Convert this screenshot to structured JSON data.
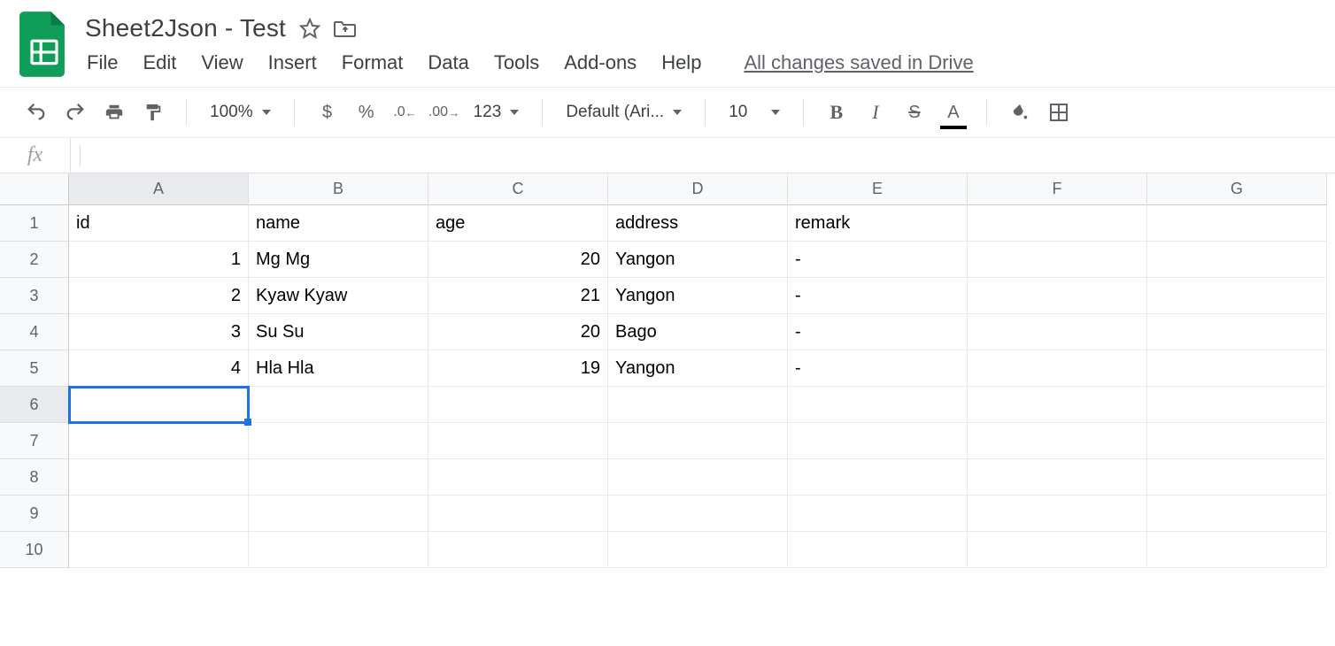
{
  "header": {
    "title": "Sheet2Json - Test",
    "menus": [
      "File",
      "Edit",
      "View",
      "Insert",
      "Format",
      "Data",
      "Tools",
      "Add-ons",
      "Help"
    ],
    "save_status": "All changes saved in Drive"
  },
  "toolbar": {
    "zoom": "100%",
    "format_123": "123",
    "font_name": "Default (Ari...",
    "font_size": "10"
  },
  "formula_bar": {
    "fx": "fx",
    "value": ""
  },
  "grid": {
    "columns": [
      "A",
      "B",
      "C",
      "D",
      "E",
      "F",
      "G"
    ],
    "row_count": 10,
    "selected_cell": {
      "row": 6,
      "col": 0
    },
    "rows": [
      [
        "id",
        "name",
        "age",
        "address",
        "remark",
        "",
        ""
      ],
      [
        "1",
        "Mg Mg",
        "20",
        "Yangon",
        "-",
        "",
        ""
      ],
      [
        "2",
        "Kyaw Kyaw",
        "21",
        "Yangon",
        "-",
        "",
        ""
      ],
      [
        "3",
        "Su Su",
        "20",
        "Bago",
        "-",
        "",
        ""
      ],
      [
        "4",
        "Hla Hla",
        "19",
        "Yangon",
        "-",
        "",
        ""
      ],
      [
        "",
        "",
        "",
        "",
        "",
        "",
        ""
      ],
      [
        "",
        "",
        "",
        "",
        "",
        "",
        ""
      ],
      [
        "",
        "",
        "",
        "",
        "",
        "",
        ""
      ],
      [
        "",
        "",
        "",
        "",
        "",
        "",
        ""
      ],
      [
        "",
        "",
        "",
        "",
        "",
        "",
        ""
      ]
    ],
    "numeric_cols_by_row": {
      "0": [],
      "default": [
        0,
        2
      ]
    }
  }
}
